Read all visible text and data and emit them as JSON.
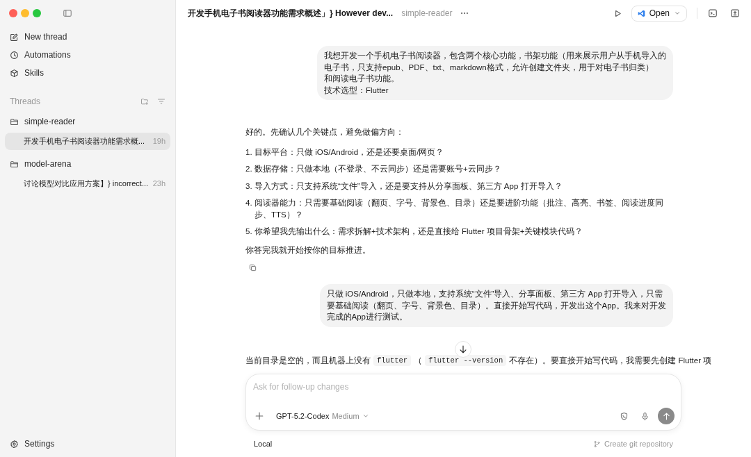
{
  "window": {
    "title": "开发手机电子书阅读器功能需求概述」} However dev...",
    "project": "simple-reader",
    "open_label": "Open"
  },
  "sidebar": {
    "nav": [
      {
        "label": "New thread",
        "kind": "edit"
      },
      {
        "label": "Automations",
        "kind": "clock"
      },
      {
        "label": "Skills",
        "kind": "cube"
      }
    ],
    "threads_heading": "Threads",
    "projects": [
      {
        "name": "simple-reader",
        "threads": [
          {
            "title": "开发手机电子书阅读器功能需求概...",
            "time": "19h",
            "selected": true
          }
        ]
      },
      {
        "name": "model-arena",
        "threads": [
          {
            "title": "讨论模型对比应用方案】} incorrect...",
            "time": "23h",
            "selected": false
          }
        ]
      }
    ],
    "settings_label": "Settings"
  },
  "messages": [
    {
      "kind": "user",
      "lines": [
        "我想开发一个手机电子书阅读器，包含两个核心功能，书架功能（用来展示用户从手机导入的",
        "电子书，只支持epub、PDF、txt、markdown格式，允许创建文件夹，用于对电子书归类）",
        "和阅读电子书功能。",
        "技术选型：Flutter"
      ]
    },
    {
      "kind": "assistant",
      "intro": "好的。先确认几个关键点，避免做偏方向：",
      "items": [
        {
          "number": "1.",
          "text": "目标平台：只做 iOS/Android，还是还要桌面/网页？"
        },
        {
          "number": "2.",
          "text": "数据存储：只做本地（不登录、不云同步）还是需要账号+云同步？"
        },
        {
          "number": "3.",
          "text": "导入方式：只支持系统“文件”导入，还是要支持从分享面板、第三方 App 打开导入？"
        },
        {
          "number": "4.",
          "text": "阅读器能力：只需要基础阅读（翻页、字号、背景色、目录）还是要进阶功能（批注、高亮、书签、阅读进度同步、TTS）？"
        },
        {
          "number": "5.",
          "text": "你希望我先输出什么：需求拆解+技术架构，还是直接给 Flutter 项目骨架+关键模块代码？"
        }
      ],
      "outro": "你答完我就开始按你的目标推进。"
    },
    {
      "kind": "user",
      "lines": [
        "只做 iOS/Android，只做本地，支持系统“文件”导入、分享面板、第三方 App 打开导入，只需",
        "要基础阅读（翻页、字号、背景色、目录）。直接开始写代码，开发出这个App。我来对开发",
        "完成的App进行测试。"
      ]
    },
    {
      "kind": "assistant_line",
      "segments": [
        {
          "kind": "text",
          "text": "当前目录是空的，而且机器上没有"
        },
        {
          "kind": "code",
          "text": "flutter"
        },
        {
          "kind": "text",
          "text": "（"
        },
        {
          "kind": "code",
          "text": "flutter --version"
        },
        {
          "kind": "text",
          "text": "不存在）。要直接开始写代码，我需要先创建 Flutter 项"
        }
      ]
    }
  ],
  "composer": {
    "placeholder": "Ask for follow-up changes",
    "model": "GPT-5.2-Codex",
    "effort": "Medium"
  },
  "footer": {
    "location": "Local",
    "git_action": "Create git repository"
  }
}
